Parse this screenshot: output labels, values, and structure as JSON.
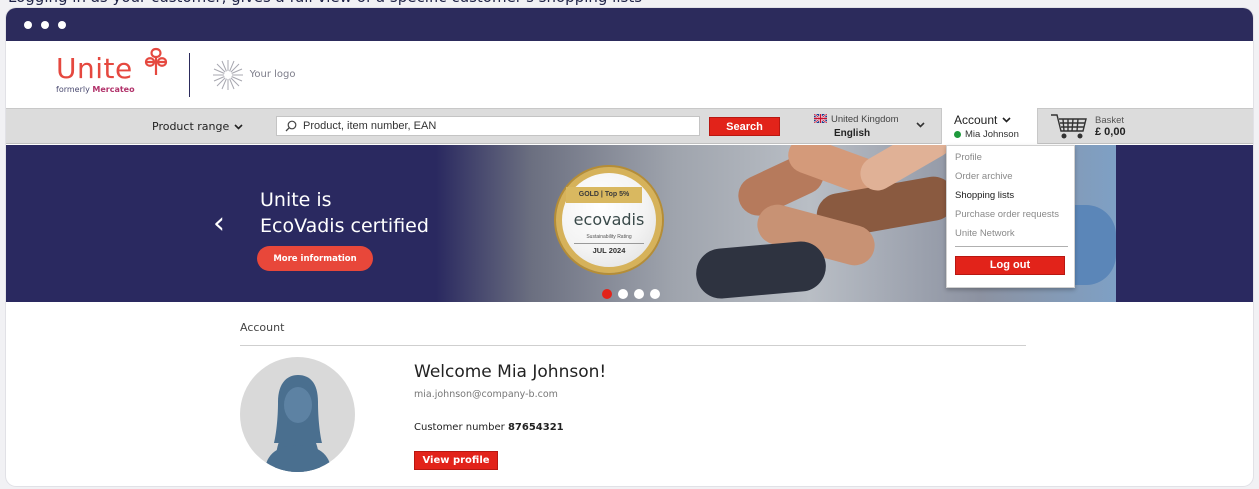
{
  "caption": "Logging in as your customer, gives a full view of a specific customer's shopping lists",
  "brand": {
    "name": "Unite",
    "formerly_prefix": "formerly",
    "formerly_name": "Mercateo",
    "your_logo": "Your logo",
    "accent_color": "#e5483f"
  },
  "nav": {
    "product_range": "Product range",
    "search_placeholder": "Product, item number, EAN",
    "search_button": "Search",
    "country": "United Kingdom",
    "language": "English",
    "account_label": "Account",
    "account_user": "Mia Johnson",
    "basket_label": "Basket",
    "basket_amount": "£ 0,00"
  },
  "banner": {
    "title_line1": "Unite is",
    "title_line2": "EcoVadis certified",
    "more_button": "More information",
    "badge_gold": "GOLD | Top 5%",
    "badge_brand": "ecovadis",
    "badge_rating": "Sustainability Rating",
    "badge_date": "JUL 2024",
    "slide_count": 4,
    "active_slide": 1
  },
  "account_menu": {
    "items": [
      {
        "label": "Profile",
        "emphasis": false
      },
      {
        "label": "Order archive",
        "emphasis": false
      },
      {
        "label": "Shopping lists",
        "emphasis": true
      },
      {
        "label": "Purchase order requests",
        "emphasis": false
      },
      {
        "label": "Unite Network",
        "emphasis": false
      }
    ],
    "logout_button": "Log out"
  },
  "account_page": {
    "breadcrumb": "Account",
    "welcome": "Welcome Mia Johnson!",
    "email": "mia.johnson@company-b.com",
    "customer_number_label": "Customer number",
    "customer_number": "87654321",
    "view_profile_button": "View profile"
  }
}
